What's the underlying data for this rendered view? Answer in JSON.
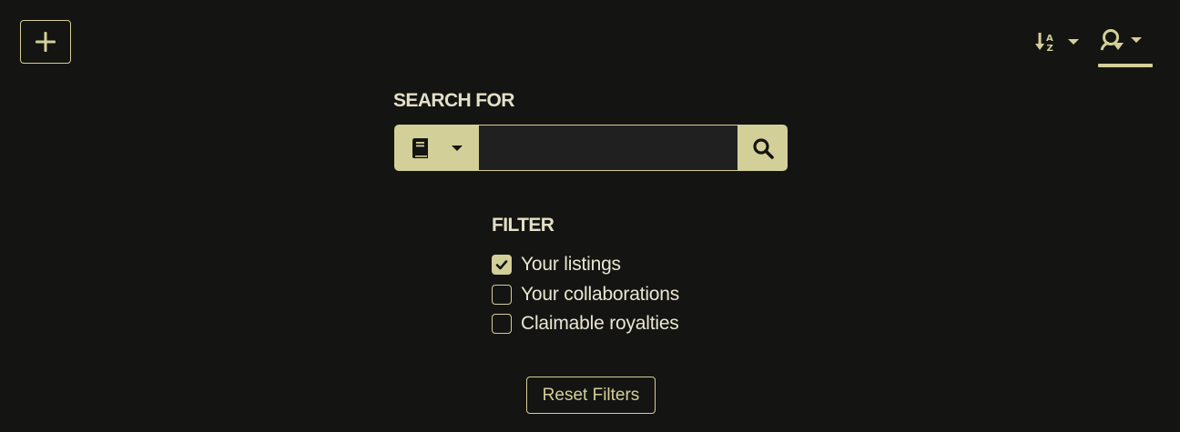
{
  "toolbar": {
    "add_icon": "plus-icon",
    "sort_icon": "sort-alpha-down-icon",
    "user_filter_icon": "user-filter-icon"
  },
  "search": {
    "title": "SEARCH FOR",
    "type_icon": "book-icon",
    "value": "",
    "placeholder": "",
    "button_icon": "search-icon"
  },
  "filter": {
    "title": "FILTER",
    "items": [
      {
        "label": "Your listings",
        "checked": true
      },
      {
        "label": "Your collaborations",
        "checked": false
      },
      {
        "label": "Claimable royalties",
        "checked": false
      }
    ]
  },
  "reset_label": "Reset Filters",
  "colors": {
    "accent": "#d3cf99",
    "background": "#141412",
    "input_bg": "#202020",
    "text": "#e8e6d2"
  }
}
